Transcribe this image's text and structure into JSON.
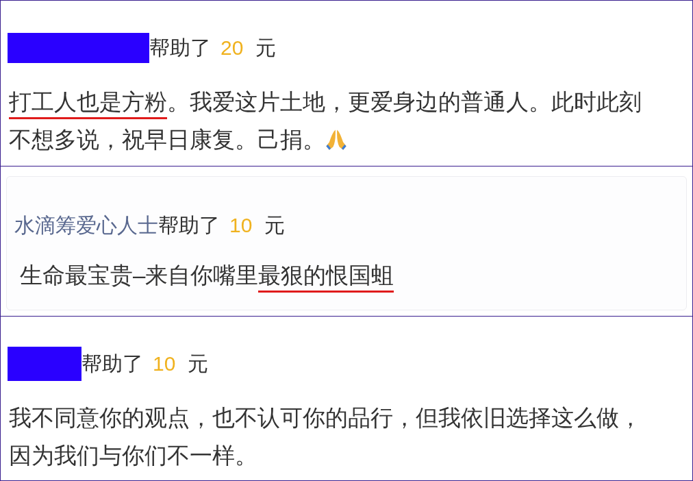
{
  "comments": [
    {
      "donor": {
        "kind": "redacted"
      },
      "helped": "帮助了",
      "amount": "20",
      "unit": "元",
      "boxed": false,
      "comment": [
        {
          "text": "打工人也是方粉",
          "underlined": true
        },
        {
          "text": "。我爱这片土地，更爱身边的普通人。此时此刻不想多说，祝早日康复。己捐。",
          "underlined": false
        }
      ],
      "emoji": true
    },
    {
      "donor": {
        "kind": "name",
        "name": "水滴筹爱心人士"
      },
      "helped": "帮助了",
      "amount": "10",
      "unit": "元",
      "boxed": true,
      "comment": [
        {
          "text": "生命最宝贵–来自你嘴里",
          "underlined": false
        },
        {
          "text": "最狠的恨国蛆",
          "underlined": true
        }
      ]
    },
    {
      "donor": {
        "kind": "redacted_short"
      },
      "helped": "帮助了",
      "amount": "10",
      "unit": "元",
      "boxed": false,
      "comment": [
        {
          "text": "我不同意你的观点，也不认可你的品行，但我依旧选择这么做，因为我们与你们不一样。",
          "underlined": false
        }
      ]
    }
  ]
}
